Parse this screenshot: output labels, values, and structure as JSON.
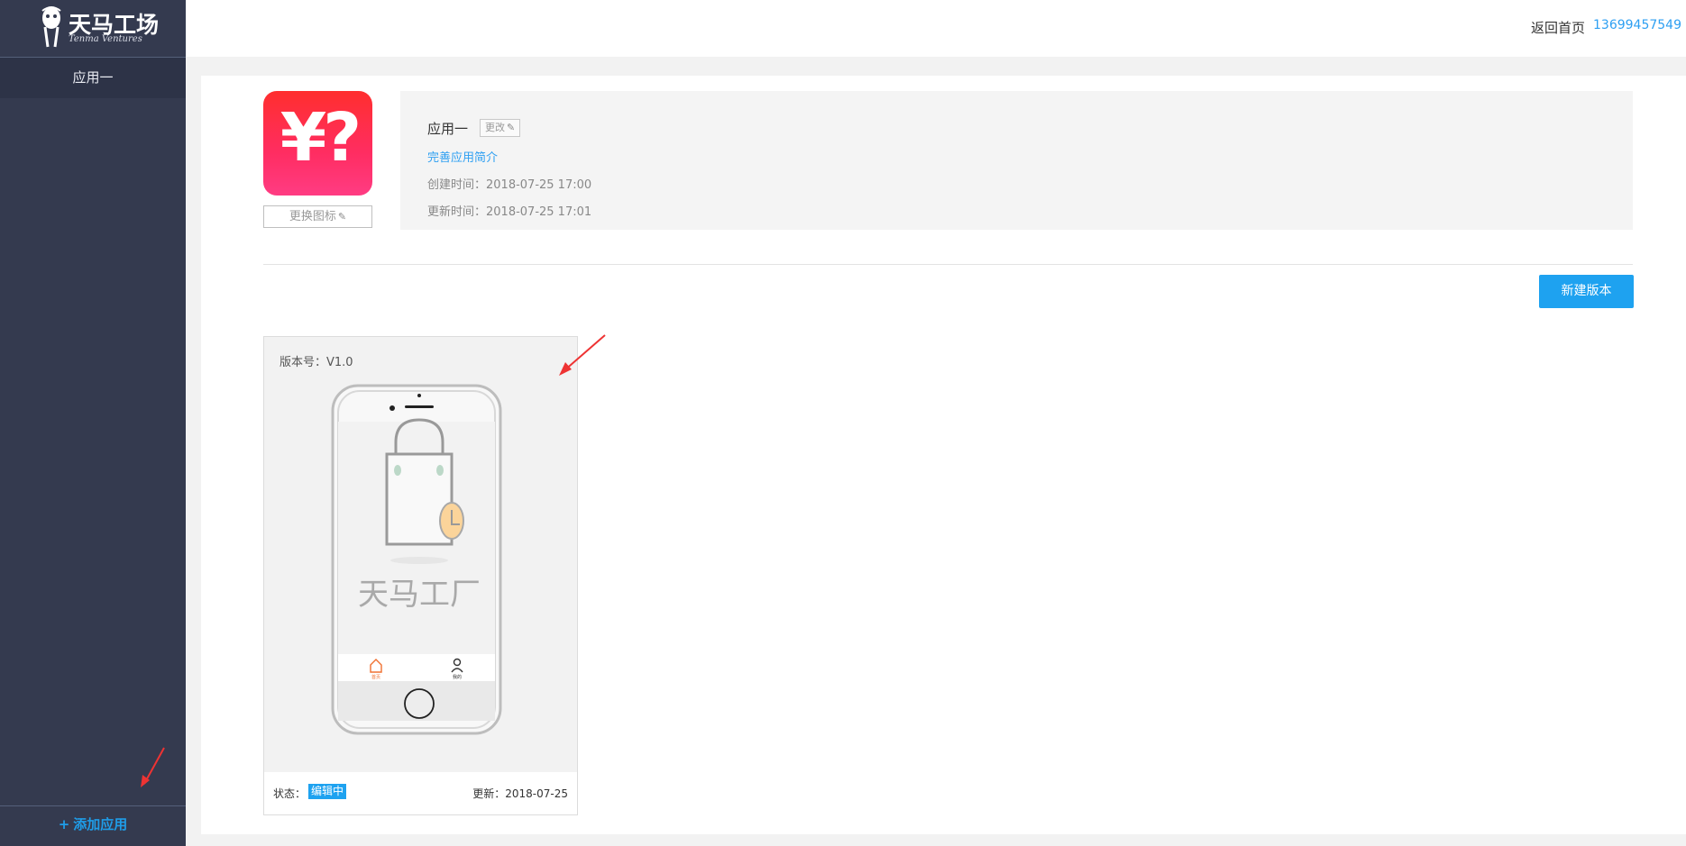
{
  "sidebar": {
    "logo_cn": "天马工场",
    "logo_en": "Tenma Ventures",
    "items": [
      {
        "label": "应用一"
      }
    ],
    "add_app_label": "添加应用",
    "add_app_prefix": "+"
  },
  "header": {
    "home_link": "返回首页",
    "phone": "13699457549"
  },
  "app": {
    "name": "应用一",
    "rename_label": "更改",
    "intro_link": "完善应用简介",
    "created": "创建时间：2018-07-25 17:00",
    "updated": "更新时间：2018-07-25 17:01",
    "change_icon_label": "更换图标",
    "icon_glyph": "¥?",
    "icon_colors": {
      "top": "#ff2e2e",
      "bottom": "#ff3c83"
    }
  },
  "toolbar": {
    "new_version_label": "新建版本"
  },
  "version_card": {
    "version_label": "版本号：V1.0",
    "splash_text": "天马工厂",
    "tab_home": "首页",
    "tab_mine": "我的",
    "status_label": "状态：",
    "status_value": "编辑中",
    "updated": "更新：2018-07-25"
  },
  "colors": {
    "sidebar_bg": "#343a4f",
    "accent_blue": "#1ea2f0",
    "annotation_red": "#ee3333"
  }
}
